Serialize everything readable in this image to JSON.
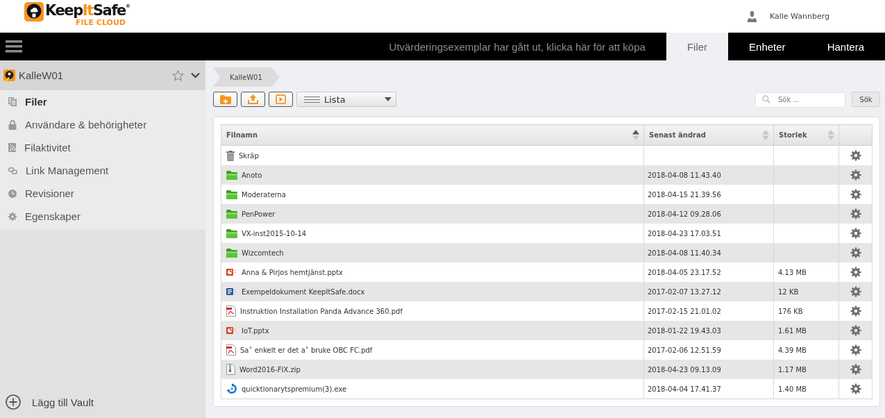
{
  "header": {
    "logo": {
      "wordmark": [
        {
          "text": "Keep",
          "accent": false
        },
        {
          "text": "It",
          "accent": true
        },
        {
          "text": "Safe",
          "accent": false
        }
      ],
      "registered": "®",
      "tagline": "FILE CLOUD"
    },
    "user": {
      "name": "Kalle Wannberg"
    }
  },
  "navbar": {
    "notice": "Utvärderingsexemplar har gått ut, klicka här för att köpa",
    "tabs": [
      {
        "label": "Filer",
        "selected": true
      },
      {
        "label": "Enheter",
        "selected": false
      },
      {
        "label": "Hantera",
        "selected": false
      }
    ]
  },
  "sidebar": {
    "vault": {
      "name": "KalleW01",
      "starred": false
    },
    "items": [
      {
        "label": "Filer",
        "selected": true
      },
      {
        "label": "Användare & behörigheter",
        "selected": false
      },
      {
        "label": "Filaktivitet",
        "selected": false
      },
      {
        "label": "Link Management",
        "selected": false
      },
      {
        "label": "Revisioner",
        "selected": false
      },
      {
        "label": "Egenskaper",
        "selected": false
      }
    ],
    "add_vault": "Lägg till Vault"
  },
  "breadcrumb": [
    "KalleW01"
  ],
  "toolbar": {
    "view": "Lista",
    "search": {
      "placeholder": "Sök ...",
      "button": "Sök"
    }
  },
  "table": {
    "columns": [
      {
        "label": "Filnamn",
        "sorted": true
      },
      {
        "label": "Senast ändrad",
        "sorted": false
      },
      {
        "label": "Storlek",
        "sorted": false
      }
    ],
    "rows": [
      {
        "kind": "trash",
        "name": "Skräp"
      },
      {
        "kind": "folder",
        "name": "Anoto",
        "modified": "2018-04-08 11.43.40"
      },
      {
        "kind": "folder",
        "name": "Moderaterna",
        "modified": "2018-04-15 21.39.56"
      },
      {
        "kind": "folder",
        "name": "PenPower",
        "modified": "2018-04-12 09.28.06"
      },
      {
        "kind": "folder",
        "name": "VX-inst2015-10-14",
        "modified": "2018-04-23 17.03.51"
      },
      {
        "kind": "folder",
        "name": "Wizcomtech",
        "modified": "2018-04-08 11.40.34"
      },
      {
        "kind": "pptx",
        "name": "Anna & Pirjos hemtjänst.pptx",
        "modified": "2018-04-05 23.17.52",
        "size": "4.13 MB"
      },
      {
        "kind": "docx",
        "name": "Exempeldokument KeepItSafe.docx",
        "modified": "2017-02-07 13.27.12",
        "size": "12 KB"
      },
      {
        "kind": "pdf",
        "name": "Instruktion Installation Panda Advance 360.pdf",
        "modified": "2017-02-15 21.01.02",
        "size": "176 KB"
      },
      {
        "kind": "pptx",
        "name": "IoT.pptx",
        "modified": "2018-01-22 19.43.03",
        "size": "1.61 MB"
      },
      {
        "kind": "pdf",
        "name": "Sa˚ enkelt er det a˚ bruke OBC FC.pdf",
        "modified": "2017-02-06 12.51.59",
        "size": "4.39 MB"
      },
      {
        "kind": "zip",
        "name": "Word2016-FIX.zip",
        "modified": "2018-04-23 09.13.09",
        "size": "1.17 MB"
      },
      {
        "kind": "exe",
        "name": "quicktionarytspremium(3).exe",
        "modified": "2018-04-04 17.41.37",
        "size": "1.40 MB"
      }
    ]
  }
}
